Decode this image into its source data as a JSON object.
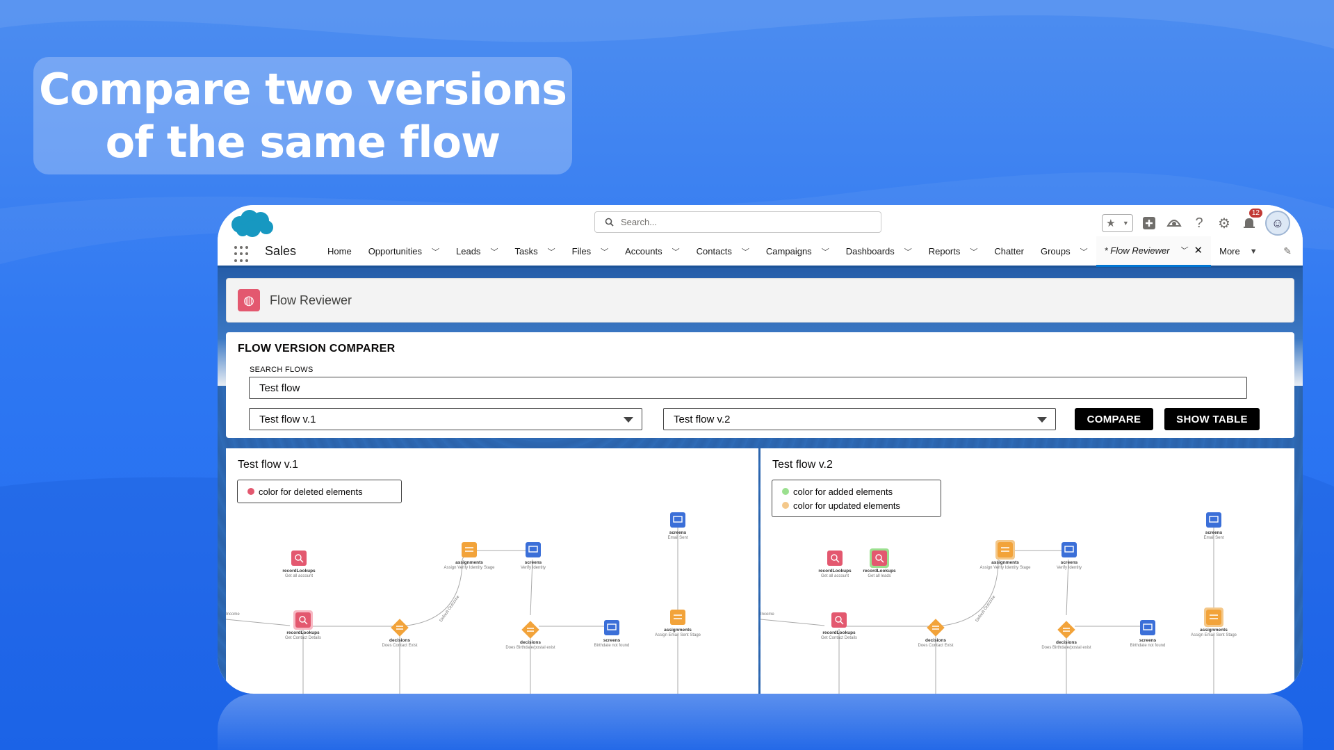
{
  "headline": {
    "line1": "Compare two versions",
    "line2": "of the same flow"
  },
  "header": {
    "search_placeholder": "Search...",
    "notification_count": "12",
    "app_name": "Sales",
    "nav": [
      {
        "label": "Home",
        "has_menu": false
      },
      {
        "label": "Opportunities",
        "has_menu": true
      },
      {
        "label": "Leads",
        "has_menu": true
      },
      {
        "label": "Tasks",
        "has_menu": true
      },
      {
        "label": "Files",
        "has_menu": true
      },
      {
        "label": "Accounts",
        "has_menu": true
      },
      {
        "label": "Contacts",
        "has_menu": true
      },
      {
        "label": "Campaigns",
        "has_menu": true
      },
      {
        "label": "Dashboards",
        "has_menu": true
      },
      {
        "label": "Reports",
        "has_menu": true
      },
      {
        "label": "Chatter",
        "has_menu": false
      },
      {
        "label": "Groups",
        "has_menu": true
      }
    ],
    "active_tab": "* Flow Reviewer",
    "more_label": "More"
  },
  "app_header": {
    "title": "Flow Reviewer"
  },
  "comparer": {
    "title": "FLOW VERSION COMPARER",
    "search_label": "SEARCH FLOWS",
    "search_value": "Test flow",
    "left_select": "Test flow v.1",
    "right_select": "Test flow v.2",
    "compare_label": "COMPARE",
    "show_table_label": "SHOW TABLE"
  },
  "left_panel": {
    "title": "Test flow v.1",
    "legend": [
      {
        "label": "color for deleted elements",
        "color": "#e3586f"
      }
    ]
  },
  "right_panel": {
    "title": "Test flow v.2",
    "legend": [
      {
        "label": "color for added elements",
        "color": "#9be08f"
      },
      {
        "label": "color for updated elements",
        "color": "#f4c88a"
      }
    ]
  },
  "flow_nodes": {
    "screens_email_sent": {
      "type": "screens",
      "sub": "Email Sent"
    },
    "assignments_verify": {
      "type": "assignments",
      "sub": "Assign Verify Identity Stage"
    },
    "screens_verify": {
      "type": "screens",
      "sub": "Verify Identity"
    },
    "recordlookups_all_account": {
      "type": "recordLookups",
      "sub": "Get all account"
    },
    "recordlookups_all_leads": {
      "type": "recordLookups",
      "sub": "Get all leads"
    },
    "recordlookups_contact": {
      "type": "recordLookups",
      "sub": "Get Contact Details"
    },
    "decisions_contact_exist": {
      "type": "decisions",
      "sub": "Does Contact Exist"
    },
    "decisions_birthdate": {
      "type": "decisions",
      "sub": "Does Birthdate/postal exist"
    },
    "screens_birthdate_not_found": {
      "type": "screens",
      "sub": "Birthdate not found"
    },
    "assignments_email_sent": {
      "type": "assignments",
      "sub": "Assign Email Sent Stage"
    },
    "edge_default_outcome": "Default Outcome",
    "edge_income": "Income"
  },
  "colors": {
    "screens": "#3b6fd8",
    "assignments": "#f2a33a",
    "decisions": "#f2a33a",
    "recordLookups": "#e3586f",
    "primary_button": "#000000"
  }
}
